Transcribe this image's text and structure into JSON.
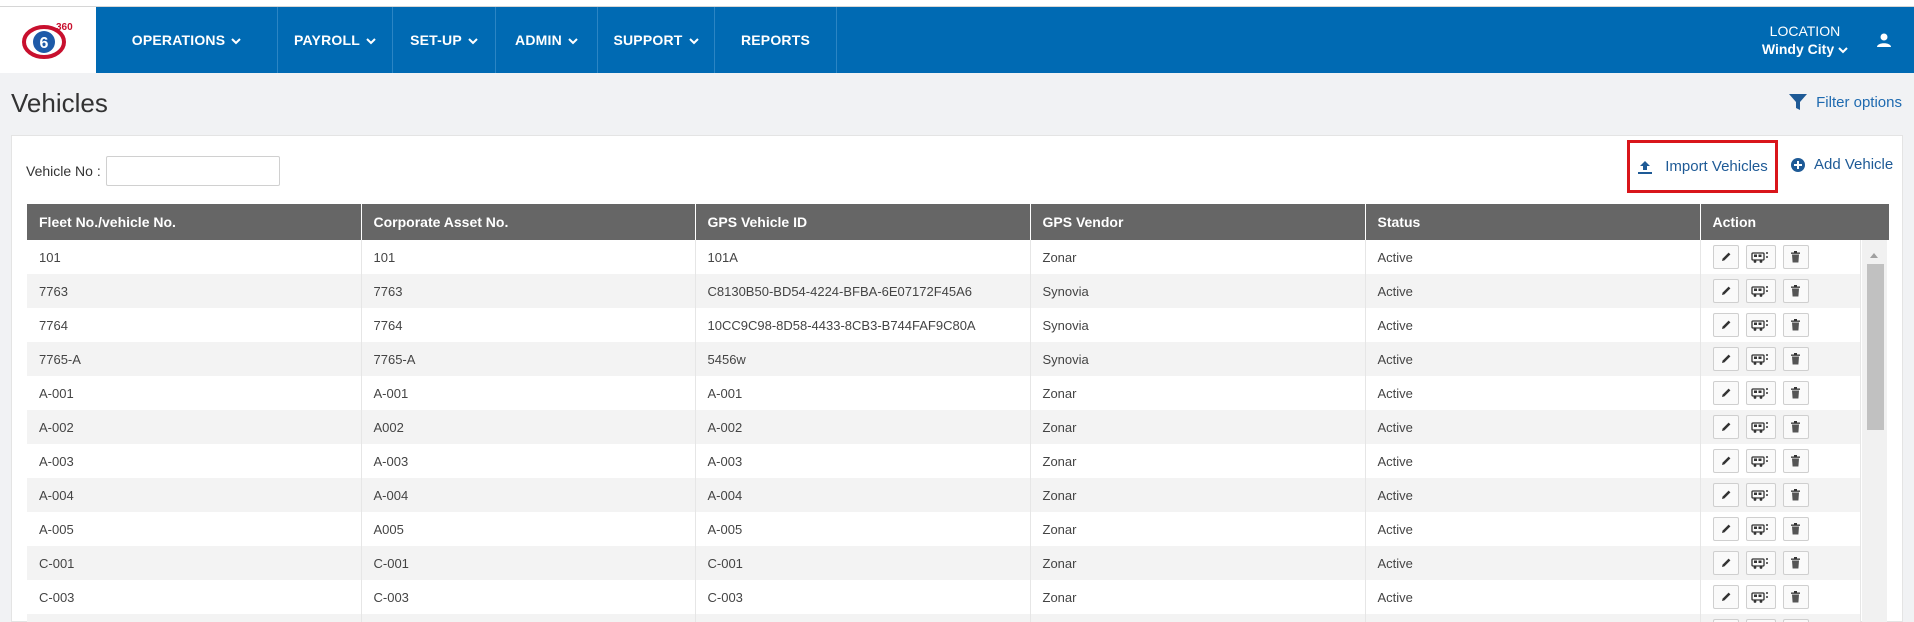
{
  "nav": {
    "items": [
      {
        "label": "OPERATIONS",
        "dropdown": true
      },
      {
        "label": "PAYROLL",
        "dropdown": true
      },
      {
        "label": "SET-UP",
        "dropdown": true
      },
      {
        "label": "ADMIN",
        "dropdown": true
      },
      {
        "label": "SUPPORT",
        "dropdown": true
      },
      {
        "label": "REPORTS",
        "dropdown": false
      }
    ],
    "location_label": "LOCATION",
    "location_value": "Windy City"
  },
  "page": {
    "title": "Vehicles",
    "filter_label": "Filter options"
  },
  "search": {
    "label": "Vehicle No :",
    "value": ""
  },
  "toolbar": {
    "import_label": "Import Vehicles",
    "add_label": "Add Vehicle"
  },
  "table": {
    "columns": [
      "Fleet No./vehicle No.",
      "Corporate Asset No.",
      "GPS Vehicle ID",
      "GPS Vendor",
      "Status",
      "Action"
    ],
    "rows": [
      [
        "101",
        "101",
        "101A",
        "Zonar",
        "Active"
      ],
      [
        "7763",
        "7763",
        "C8130B50-BD54-4224-BFBA-6E07172F45A6",
        "Synovia",
        "Active"
      ],
      [
        "7764",
        "7764",
        "10CC9C98-8D58-4433-8CB3-B744FAF9C80A",
        "Synovia",
        "Active"
      ],
      [
        "7765-A",
        "7765-A",
        "5456w",
        "Synovia",
        "Active"
      ],
      [
        "A-001",
        "A-001",
        "A-001",
        "Zonar",
        "Active"
      ],
      [
        "A-002",
        "A002",
        "A-002",
        "Zonar",
        "Active"
      ],
      [
        "A-003",
        "A-003",
        "A-003",
        "Zonar",
        "Active"
      ],
      [
        "A-004",
        "A-004",
        "A-004",
        "Zonar",
        "Active"
      ],
      [
        "A-005",
        "A005",
        "A-005",
        "Zonar",
        "Active"
      ],
      [
        "C-001",
        "C-001",
        "C-001",
        "Zonar",
        "Active"
      ],
      [
        "C-003",
        "C-003",
        "C-003",
        "Zonar",
        "Active"
      ],
      [
        "",
        "",
        "",
        "",
        ""
      ]
    ],
    "row_actions": [
      "edit-icon",
      "bus-settings-icon",
      "delete-icon"
    ]
  },
  "colors": {
    "nav_bg": "#006ab3",
    "header_bg": "#666666",
    "link": "#1e5a96",
    "highlight": "#d9151b"
  }
}
